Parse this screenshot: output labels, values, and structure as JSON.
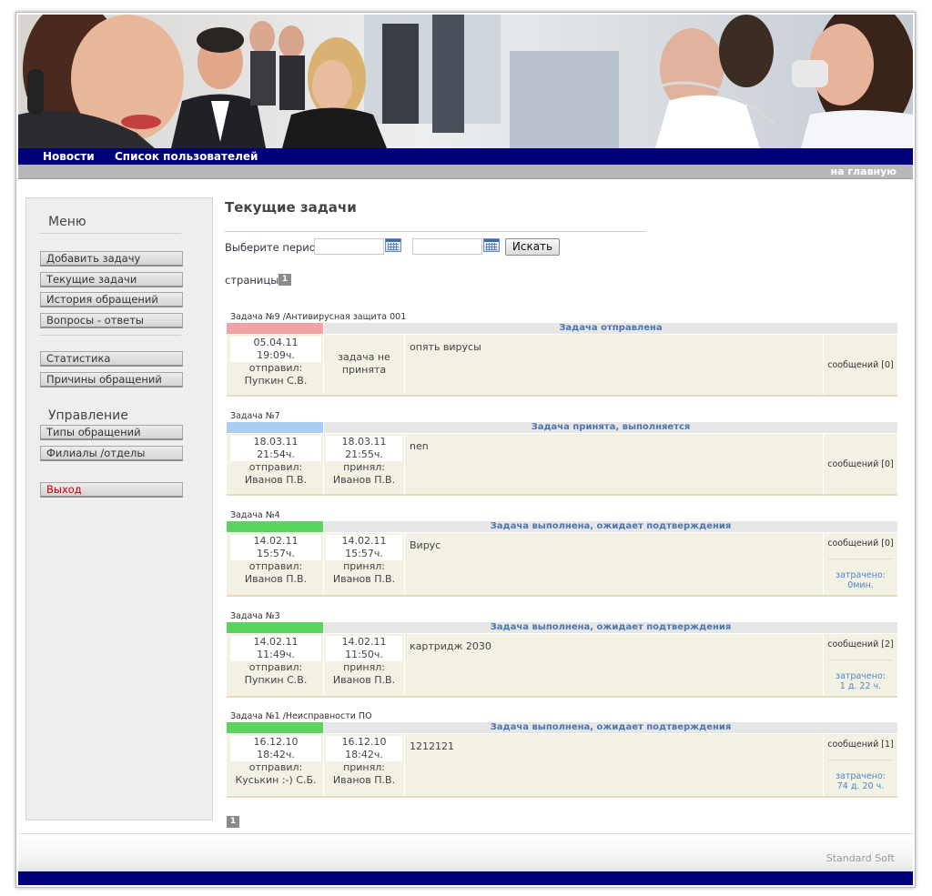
{
  "nav": {
    "news": "Новости",
    "users": "Список пользователей",
    "home": "на главную"
  },
  "sidebar": {
    "title": "Меню",
    "items": [
      "Добавить задачу",
      "Текущие задачи",
      "История обращений",
      "Вопросы - ответы"
    ],
    "items2": [
      "Статистика",
      "Причины обращений"
    ],
    "management_title": "Управление",
    "items3": [
      "Типы обращений",
      "Филиалы /отделы"
    ],
    "logout": "Выход"
  },
  "main": {
    "title": "Текущие задачи",
    "period_label": "Выберите период:",
    "search_button": "Искать",
    "pages_label": "страницы:",
    "page_number": "1"
  },
  "colors": {
    "nav": "#00007b",
    "pink": "#f1a2a5",
    "blue": "#a8cff2",
    "green": "#5bd35f"
  },
  "tasks": [
    {
      "caption": "Задача №9 /Антивирусная защита 001",
      "status": "Задача отправлена",
      "strip_color": "#f1a2a5",
      "sent_date": "05.04.11",
      "sent_time": "19:09ч.",
      "sent_label": "отправил:",
      "sender": "Пупкин С.В.",
      "accepted_text": "задача не принята",
      "text": "опять вирусы",
      "messages": "сообщений [0]"
    },
    {
      "caption": "Задача №7",
      "status": "Задача принята, выполняется",
      "strip_color": "#a8cff2",
      "sent_date": "18.03.11",
      "sent_time": "21:54ч.",
      "sent_label": "отправил:",
      "sender": "Иванов П.В.",
      "acc_date": "18.03.11",
      "acc_time": "21:55ч.",
      "acc_label": "принял:",
      "acceptor": "Иванов П.В.",
      "text": "nen",
      "messages": "сообщений [0]"
    },
    {
      "caption": "Задача №4",
      "status": "Задача выполнена, ожидает подтверждения",
      "strip_color": "#5bd35f",
      "sent_date": "14.02.11",
      "sent_time": "15:57ч.",
      "sent_label": "отправил:",
      "sender": "Иванов П.В.",
      "acc_date": "14.02.11",
      "acc_time": "15:57ч.",
      "acc_label": "принял:",
      "acceptor": "Иванов П.В.",
      "text": "Вирус",
      "messages": "сообщений [0]",
      "spent_label": "затрачено:",
      "spent": "0мин."
    },
    {
      "caption": "Задача №3",
      "status": "Задача выполнена, ожидает подтверждения",
      "strip_color": "#5bd35f",
      "sent_date": "14.02.11",
      "sent_time": "11:49ч.",
      "sent_label": "отправил:",
      "sender": "Пупкин С.В.",
      "acc_date": "14.02.11",
      "acc_time": "11:50ч.",
      "acc_label": "принял:",
      "acceptor": "Иванов П.В.",
      "text": "картридж 2030",
      "messages": "сообщений [2]",
      "spent_label": "затрачено:",
      "spent": "1 д. 22 ч."
    },
    {
      "caption": "Задача №1 /Неисправности ПО",
      "status": "Задача выполнена, ожидает подтверждения",
      "strip_color": "#5bd35f",
      "sent_date": "16.12.10",
      "sent_time": "18:42ч.",
      "sent_label": "отправил:",
      "sender": "Куськин :-) С.Б.",
      "acc_date": "16.12.10",
      "acc_time": "18:42ч.",
      "acc_label": "принял:",
      "acceptor": "Иванов П.В.",
      "text": "1212121",
      "messages": "сообщений [1]",
      "spent_label": "затрачено:",
      "spent": "74 д. 20 ч."
    }
  ],
  "bottom_page": "1",
  "footer": "Standard Soft"
}
